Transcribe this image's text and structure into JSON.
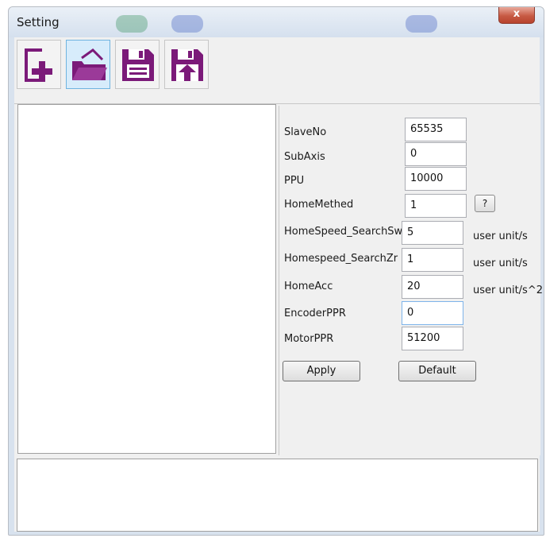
{
  "window": {
    "title": "Setting",
    "close_glyph": "x"
  },
  "toolbar": {
    "buttons": [
      {
        "icon": "new-file-icon"
      },
      {
        "icon": "open-folder-icon"
      },
      {
        "icon": "save-icon"
      },
      {
        "icon": "save-as-icon"
      }
    ],
    "accent": "#7b1a79"
  },
  "form": {
    "fields": [
      {
        "label": "SlaveNo",
        "value": "65535",
        "unit": ""
      },
      {
        "label": "SubAxis",
        "value": "0",
        "unit": ""
      },
      {
        "label": "PPU",
        "value": "10000",
        "unit": ""
      },
      {
        "label": "HomeMethed",
        "value": "1",
        "unit": ""
      },
      {
        "label": "HomeSpeed_SearchSw",
        "value": "5",
        "unit": "user unit/s"
      },
      {
        "label": "Homespeed_SearchZr",
        "value": "1",
        "unit": "user unit/s"
      },
      {
        "label": "HomeAcc",
        "value": "20",
        "unit": "user unit/s^2"
      },
      {
        "label": "EncoderPPR",
        "value": "0",
        "unit": ""
      },
      {
        "label": "MotorPPR",
        "value": "51200",
        "unit": ""
      }
    ],
    "help_label": "?",
    "apply_label": "Apply",
    "default_label": "Default"
  }
}
